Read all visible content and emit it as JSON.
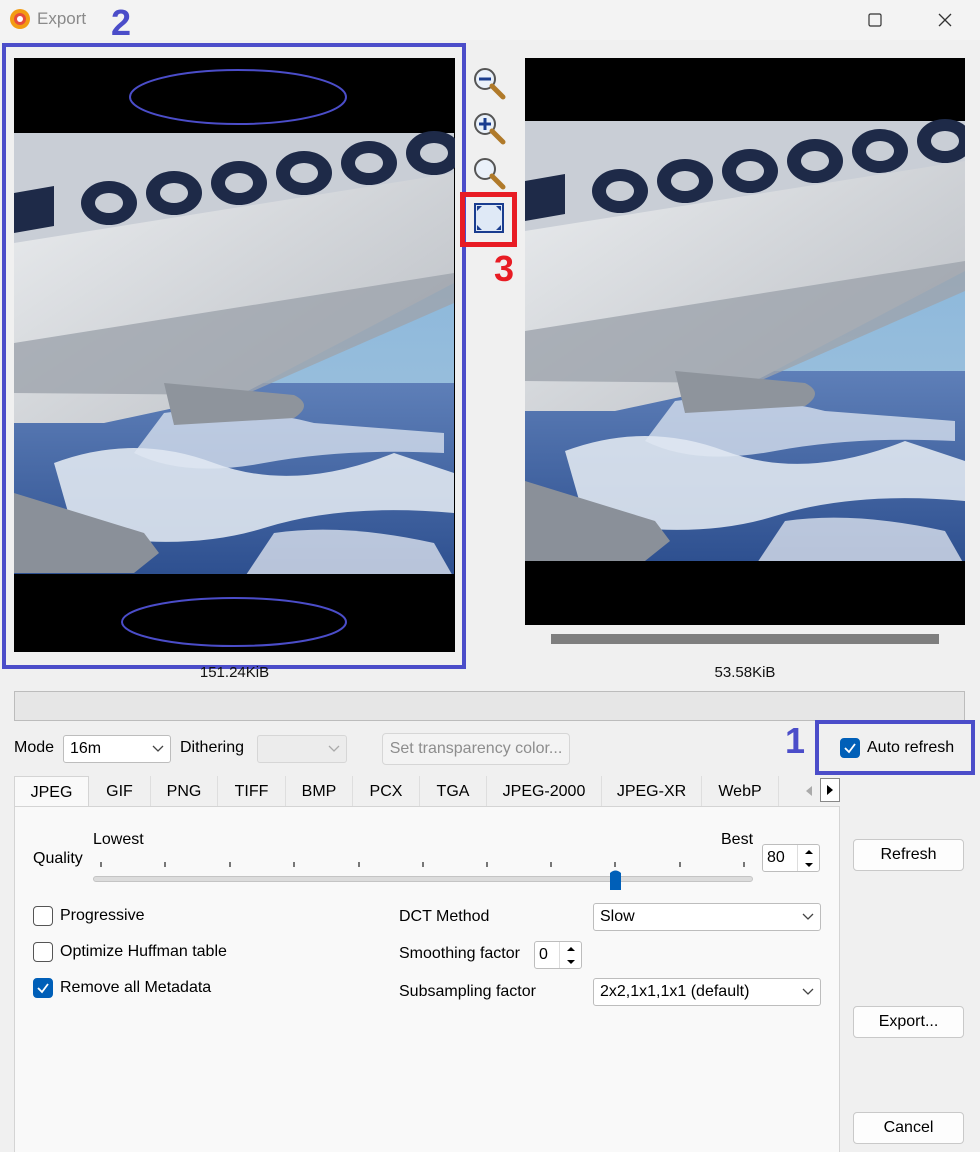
{
  "window": {
    "title": "Export"
  },
  "preview": {
    "original_size": "151.24KiB",
    "exported_size": "53.58KiB",
    "zoom_tools": [
      "zoom-out-icon",
      "zoom-in-icon",
      "zoom-actual-icon",
      "fit-to-window-icon"
    ]
  },
  "annotations": {
    "num1": "1",
    "num2": "2",
    "num3": "3"
  },
  "options": {
    "mode_label": "Mode",
    "mode_value": "16m",
    "dithering_label": "Dithering",
    "dithering_value": "",
    "transparency_button": "Set transparency color...",
    "auto_refresh_label": "Auto refresh",
    "auto_refresh_checked": true
  },
  "tabs": [
    "JPEG",
    "GIF",
    "PNG",
    "TIFF",
    "BMP",
    "PCX",
    "TGA",
    "JPEG-2000",
    "JPEG-XR",
    "WebP"
  ],
  "active_tab": "JPEG",
  "jpeg": {
    "quality_label": "Quality",
    "lowest_label": "Lowest",
    "best_label": "Best",
    "quality_value": "80",
    "progressive_label": "Progressive",
    "progressive_checked": false,
    "optimize_label": "Optimize Huffman table",
    "optimize_checked": false,
    "remove_metadata_label": "Remove all Metadata",
    "remove_metadata_checked": true,
    "dct_label": "DCT Method",
    "dct_value": "Slow",
    "smoothing_label": "Smoothing factor",
    "smoothing_value": "0",
    "subsampling_label": "Subsampling factor",
    "subsampling_value": "2x2,1x1,1x1 (default)"
  },
  "buttons": {
    "refresh": "Refresh",
    "export": "Export...",
    "cancel": "Cancel"
  },
  "colors": {
    "annotation_blue": "#4b4dc9",
    "annotation_red": "#e81c24",
    "accent": "#005fb8"
  }
}
